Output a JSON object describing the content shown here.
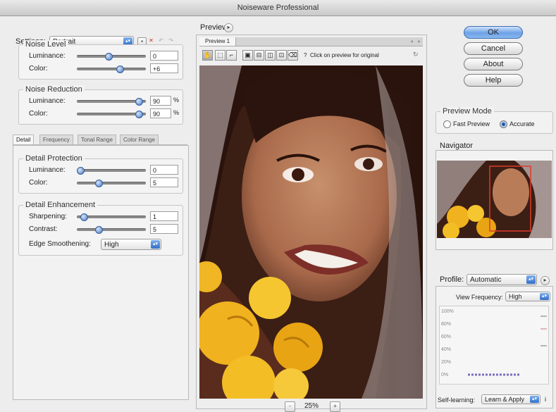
{
  "window": {
    "title": "Noiseware Professional"
  },
  "settings": {
    "label": "Settings:",
    "value": "Portrait"
  },
  "noise_level": {
    "title": "Noise Level",
    "luminance_label": "Luminance:",
    "luminance_value": "0",
    "color_label": "Color:",
    "color_value": "+6"
  },
  "noise_reduction": {
    "title": "Noise Reduction",
    "luminance_label": "Luminance:",
    "luminance_value": "90",
    "luminance_unit": "%",
    "color_label": "Color:",
    "color_value": "90",
    "color_unit": "%"
  },
  "tabs": [
    "Detail",
    "Frequency",
    "Tonal Range",
    "Color Range"
  ],
  "detail_protection": {
    "title": "Detail Protection",
    "luminance_label": "Luminance:",
    "luminance_value": "0",
    "color_label": "Color:",
    "color_value": "5"
  },
  "detail_enhancement": {
    "title": "Detail Enhancement",
    "sharpening_label": "Sharpening:",
    "sharpening_value": "1",
    "contrast_label": "Contrast:",
    "contrast_value": "5",
    "edge_label": "Edge Smoothening:",
    "edge_value": "High"
  },
  "preview": {
    "title": "Preview",
    "tab_label": "Preview 1",
    "hint": "Click on preview for original",
    "zoom": "25%",
    "zoom_minus": "-",
    "zoom_plus": "+"
  },
  "buttons": {
    "ok": "OK",
    "cancel": "Cancel",
    "about": "About",
    "help": "Help"
  },
  "preview_mode": {
    "title": "Preview Mode",
    "fast": "Fast Preview",
    "accurate": "Accurate"
  },
  "navigator": {
    "title": "Navigator"
  },
  "profile": {
    "label": "Profile:",
    "value": "Automatic",
    "view_freq_label": "View Frequency:",
    "view_freq_value": "High",
    "yticks": [
      "100%",
      "80%",
      "60%",
      "40%",
      "20%",
      "0%"
    ],
    "self_learning_label": "Self-learning:",
    "self_learning_value": "Learn & Apply"
  },
  "colors": {
    "accent": "#3f74c2",
    "default_button": "#6ea2e6"
  },
  "slider_levels": {
    "noise_level_luminance": 0.46,
    "noise_level_color": 0.62,
    "noise_reduction_luminance": 0.9,
    "noise_reduction_color": 0.9,
    "detail_luminance": 0.05,
    "detail_color": 0.32,
    "sharpening": 0.1,
    "contrast": 0.32
  }
}
